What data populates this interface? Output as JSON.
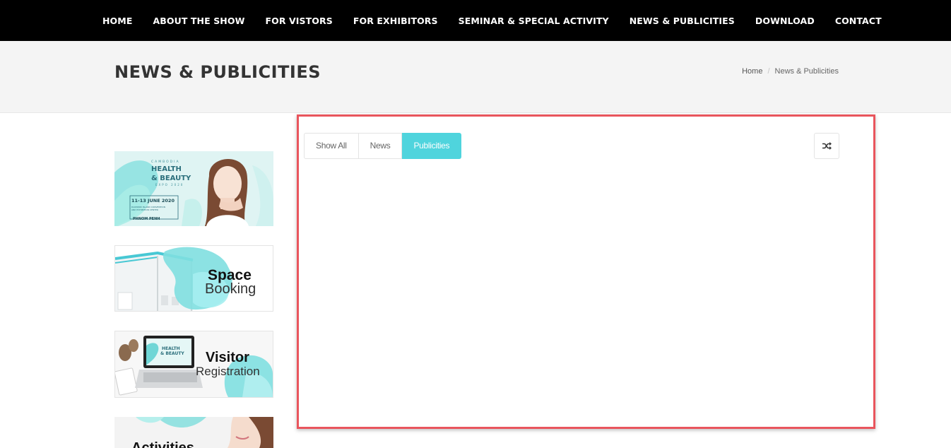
{
  "nav": {
    "items": [
      {
        "label": "HOME"
      },
      {
        "label": "ABOUT THE SHOW"
      },
      {
        "label": "FOR VISTORS"
      },
      {
        "label": "FOR EXHIBITORS"
      },
      {
        "label": "SEMINAR & SPECIAL ACTIVITY"
      },
      {
        "label": "NEWS & PUBLICITIES"
      },
      {
        "label": "DOWNLOAD"
      },
      {
        "label": "CONTACT"
      }
    ]
  },
  "header": {
    "title": "NEWS & PUBLICITIES",
    "breadcrumb": {
      "home": "Home",
      "separator": "/",
      "current": "News & Publicities"
    }
  },
  "sidebar": {
    "expo_banner": {
      "line1": "CAMBODIA",
      "line2": "HEALTH",
      "line3": "& BEAUTY",
      "line4": "EXPO 2020",
      "date": "11-13 JUNE 2020",
      "venue_line1": "DIAMOND ISLAND CONVENTION",
      "venue_line2": "AND EXHIBITION CENTER",
      "city": "PHNOM PENH"
    },
    "space_banner": {
      "line1": "Space",
      "line2": "Booking"
    },
    "visitor_banner": {
      "line1": "Visitor",
      "line2": "Registration",
      "screen_line1": "HEALTH",
      "screen_line2": "& BEAUTY"
    },
    "activities_banner": {
      "line1": "Activities"
    }
  },
  "filters": {
    "buttons": [
      {
        "label": "Show All"
      },
      {
        "label": "News"
      },
      {
        "label": "Publicities"
      }
    ],
    "active_index": 2,
    "shuffle_icon": "shuffle-icon"
  },
  "colors": {
    "accent": "#4fd4dd",
    "nav_bg": "#000000",
    "header_bg": "#f4f4f4",
    "highlight_border": "#e9555d"
  }
}
